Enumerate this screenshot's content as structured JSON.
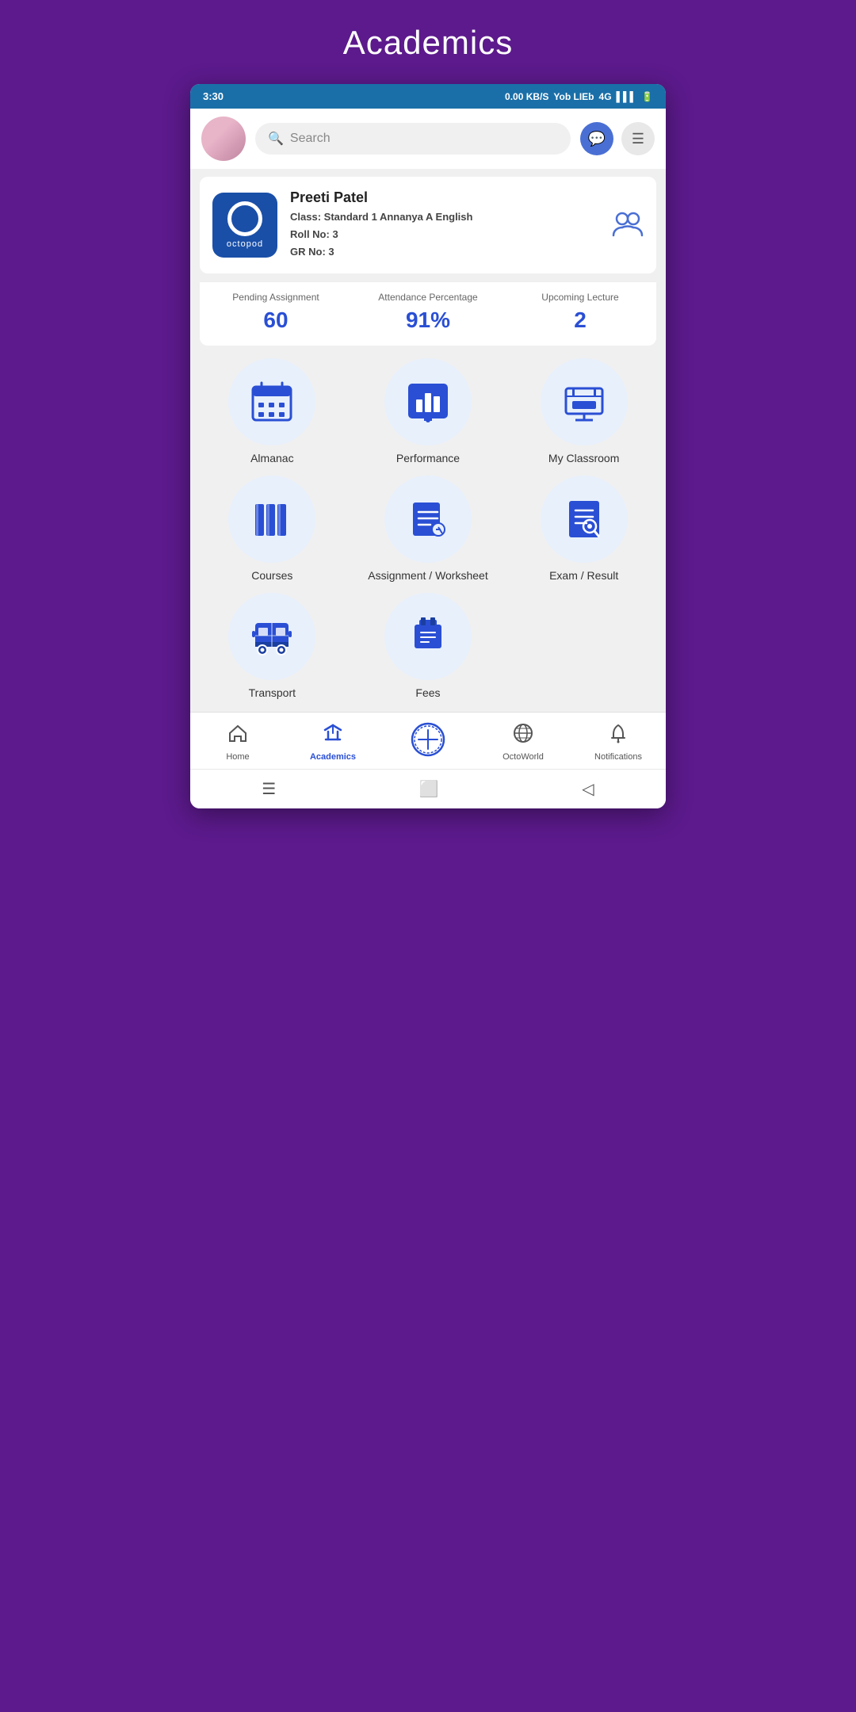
{
  "page": {
    "title": "Academics"
  },
  "statusBar": {
    "time": "3:30",
    "network": "0.00 KB/S",
    "carrier": "Yob LIEb",
    "signal": "4G"
  },
  "header": {
    "searchPlaceholder": "Search",
    "searchIcon": "search-icon",
    "chatIcon": "chat-icon",
    "menuIcon": "menu-icon"
  },
  "profile": {
    "logoText": "octopod",
    "name": "Preeti Patel",
    "classLabel": "Class:",
    "classValue": "Standard 1 Annanya A English",
    "rollLabel": "Roll No:",
    "rollValue": "3",
    "grLabel": "GR No:",
    "grValue": "3"
  },
  "stats": {
    "pendingLabel": "Pending Assignment",
    "pendingValue": "60",
    "attendanceLabel": "Attendance Percentage",
    "attendanceValue": "91%",
    "lectureLabel": "Upcoming Lecture",
    "lectureValue": "2"
  },
  "grid": [
    {
      "id": "almanac",
      "label": "Almanac",
      "icon": "calendar-icon"
    },
    {
      "id": "performance",
      "label": "Performance",
      "icon": "chart-icon"
    },
    {
      "id": "myclassroom",
      "label": "My Classroom",
      "icon": "classroom-icon"
    },
    {
      "id": "courses",
      "label": "Courses",
      "icon": "books-icon"
    },
    {
      "id": "assignment",
      "label": "Assignment / Worksheet",
      "icon": "assignment-icon"
    },
    {
      "id": "examresult",
      "label": "Exam / Result",
      "icon": "exam-icon"
    },
    {
      "id": "transport",
      "label": "Transport",
      "icon": "bus-icon"
    },
    {
      "id": "fees",
      "label": "Fees",
      "icon": "fees-icon"
    }
  ],
  "bottomNav": [
    {
      "id": "home",
      "label": "Home",
      "icon": "home-icon",
      "active": false
    },
    {
      "id": "academics",
      "label": "Academics",
      "icon": "academics-icon",
      "active": true
    },
    {
      "id": "octoworld-center",
      "label": "",
      "icon": "plus-badge-icon",
      "active": false
    },
    {
      "id": "octoworld",
      "label": "OctoWorld",
      "icon": "globe-icon",
      "active": false
    },
    {
      "id": "notifications",
      "label": "Notifications",
      "icon": "bell-icon",
      "active": false
    }
  ]
}
